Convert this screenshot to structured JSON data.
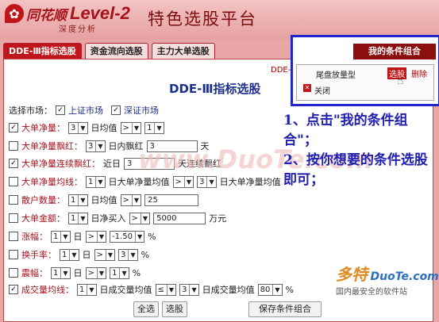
{
  "header": {
    "logo_name": "同花顺",
    "logo_level": "Level-2",
    "logo_sub": "深度分析",
    "platform_title": "特色选股平台"
  },
  "tabs": [
    {
      "label": "DDE-Ⅲ指标选股",
      "active": true
    },
    {
      "label": "资金流向选股",
      "active": false
    },
    {
      "label": "主力大单选股",
      "active": false
    }
  ],
  "panel": {
    "title": "DDE-Ⅲ指标选股",
    "corner_text": "DDE-",
    "market_label": "选择市场：",
    "markets": [
      {
        "label": "上证市场",
        "checked": true
      },
      {
        "label": "深证市场",
        "checked": true
      }
    ],
    "rows": [
      {
        "checked": true,
        "label": "大单净量：",
        "s1": "3",
        "t1": "日均值",
        "s2": ">",
        "s3": "1"
      },
      {
        "checked": false,
        "label": "大单净量飘红：",
        "s1": "3",
        "t1": "日内飘红",
        "v": "3",
        "t2": "天"
      },
      {
        "checked": true,
        "label": "大单净量连续飘红：",
        "t1": "近日",
        "v": "3",
        "t2": "天连续飘红"
      },
      {
        "checked": false,
        "label": "大单净量均线：",
        "s1": "1",
        "t1": "日大单净量均值",
        "s2": ">",
        "s3": "3",
        "t2": "日大单净量均值"
      },
      {
        "checked": false,
        "label": "散户数量：",
        "s1": "1",
        "t1": "日均值",
        "s2": ">",
        "v": "25"
      },
      {
        "checked": false,
        "label": "大单金额：",
        "s1": "1",
        "t1": "日净买入",
        "s2": ">",
        "v": "5000",
        "t2": "万元"
      },
      {
        "checked": false,
        "label": "涨幅：",
        "s1": "1",
        "t1": "日",
        "s2": ">",
        "s3": "-1.50",
        "t2": "%"
      },
      {
        "checked": false,
        "label": "换手率：",
        "s1": "1",
        "t1": "日",
        "s2": ">",
        "s3": "3",
        "t2": "%"
      },
      {
        "checked": false,
        "label": "震幅：",
        "s1": "1",
        "t1": "日",
        "s2": ">",
        "s3": "1",
        "t2": "%"
      },
      {
        "checked": true,
        "label": "成交量均线：",
        "s1": "1",
        "t1": "日成交量均值",
        "s2": "≤",
        "s3": "3",
        "t2": "日成交量均值",
        "s4": "80",
        "t3": "%"
      }
    ]
  },
  "buttons": {
    "select_all": "全选",
    "select_stock": "选股",
    "save": "保存条件组合"
  },
  "popup": {
    "title": "我的条件组合",
    "item_name": "尾盘放量型",
    "select_btn": "选股",
    "delete_btn": "删除",
    "close_label": "关闭"
  },
  "annotation": {
    "line1": "1、点击\"我的条件组合\"；",
    "line2": "2、按你想要的条件选股即可；"
  },
  "watermark": "www.DuoTe.com",
  "brand": {
    "name": "多特",
    "site": "DuoTe.com",
    "slogan": "国内最安全的软件站"
  }
}
